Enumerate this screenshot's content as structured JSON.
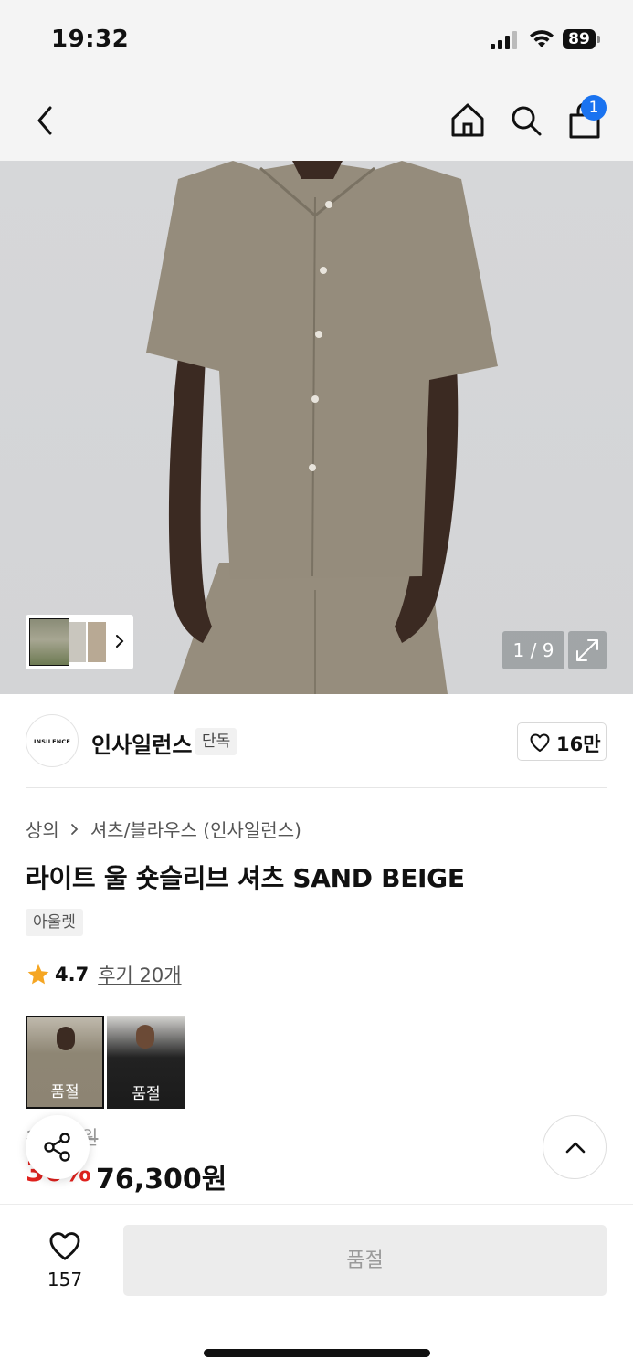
{
  "status_bar": {
    "time": "19:32",
    "battery": "89"
  },
  "nav": {
    "cart_count": "1"
  },
  "gallery": {
    "counter": "1 / 9"
  },
  "brand": {
    "logo_text": "INSILENCE",
    "name": "인사일런스",
    "tag": "단독",
    "likes": "16만"
  },
  "breadcrumb": {
    "level1": "상의",
    "level2": "셔츠/블라우스 (인사일런스)"
  },
  "product": {
    "title": "라이트 울 숏슬리브 셔츠 SAND BEIGE",
    "tag": "아울렛",
    "rating": "4.7",
    "reviews": "후기 20개",
    "color_options": [
      {
        "label": "품절"
      },
      {
        "label": "품절"
      }
    ],
    "original_price": "1··,··0원",
    "discount": "30%",
    "price": "76,300원"
  },
  "bottom_bar": {
    "wish_count": "157",
    "buy_label": "품절"
  },
  "colors": {
    "accent_blue": "#1a73f0",
    "discount_red": "#e0221e"
  },
  "icons": [
    "back-icon",
    "home-icon",
    "search-icon",
    "shopping-bag-icon",
    "chevron-right-icon",
    "expand-icon",
    "heart-icon",
    "star-icon",
    "share-icon",
    "chevron-up-icon"
  ]
}
